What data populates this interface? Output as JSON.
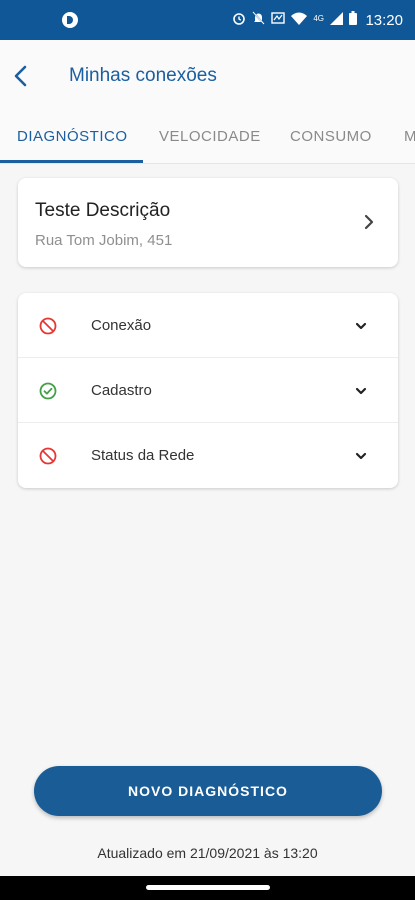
{
  "status_bar": {
    "time": "13:20",
    "network": "4G",
    "icons": [
      "alarm-icon",
      "mute-icon",
      "wifi-call-icon",
      "wifi-icon",
      "signal-icon",
      "battery-icon"
    ]
  },
  "header": {
    "title": "Minhas conexões",
    "back_icon": "arrow-back-icon"
  },
  "tabs": [
    {
      "label": "DIAGNÓSTICO",
      "active": true
    },
    {
      "label": "VELOCIDADE",
      "active": false
    },
    {
      "label": "CONSUMO",
      "active": false
    },
    {
      "label": "M",
      "active": false
    }
  ],
  "location": {
    "name": "Teste Descrição",
    "address": "Rua Tom Jobim, 451"
  },
  "diagnostics": [
    {
      "label": "Conexão",
      "status": "error",
      "icon": "block-icon",
      "color": "#e53935"
    },
    {
      "label": "Cadastro",
      "status": "ok",
      "icon": "check-circle-icon",
      "color": "#43a047"
    },
    {
      "label": "Status da Rede",
      "status": "error",
      "icon": "block-icon",
      "color": "#e53935"
    }
  ],
  "action_button": {
    "label": "NOVO DIAGNÓSTICO"
  },
  "updated_text": "Atualizado em 21/09/2021 às 13:20",
  "colors": {
    "primary": "#1a5c96",
    "error": "#e53935",
    "success": "#43a047"
  }
}
